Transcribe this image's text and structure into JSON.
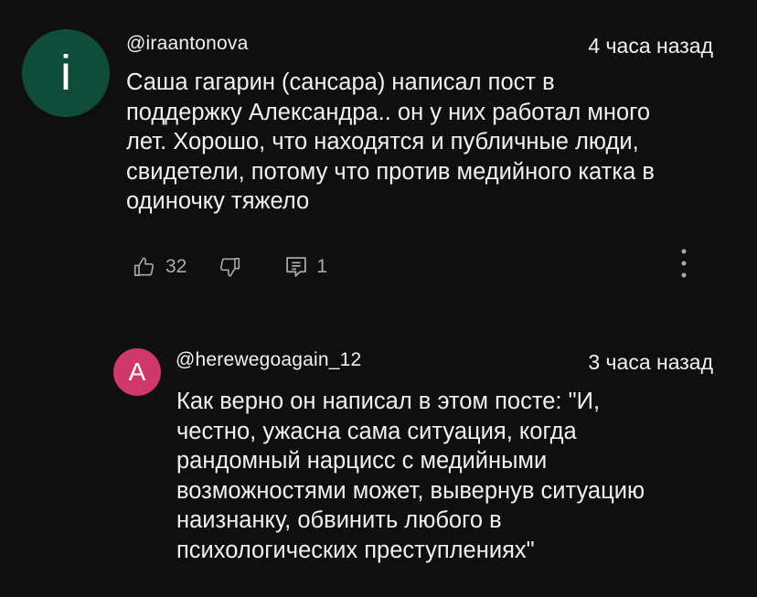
{
  "comment": {
    "avatar_letter": "i",
    "avatar_color": "#0f4c3a",
    "author": "@iraantonova",
    "time": "4 часа назад",
    "text": "Саша гагарин (сансара) написал пост в\nподдержку Александра.. он у них работал много\nлет. Хорошо, что находятся и публичные люди,\nсвидетели, потому что против медийного катка в\nодиночку тяжело",
    "likes": "32",
    "replies": "1"
  },
  "reply": {
    "avatar_letter": "A",
    "avatar_color": "#d0376b",
    "author": "@herewegoagain_12",
    "time": "3 часа назад",
    "text": "Как верно он написал в этом посте: \"И,\nчестно, ужасна сама ситуация, когда\nрандомный нарцисс с медийными\nвозможностями может, вывернув ситуацию\nнаизнанку, обвинить любого в\nпсихологических преступлениях\""
  },
  "icons": {
    "like": "thumbs-up-icon",
    "dislike": "thumbs-down-icon",
    "reply": "comment-icon",
    "more": "more-vertical-icon"
  }
}
